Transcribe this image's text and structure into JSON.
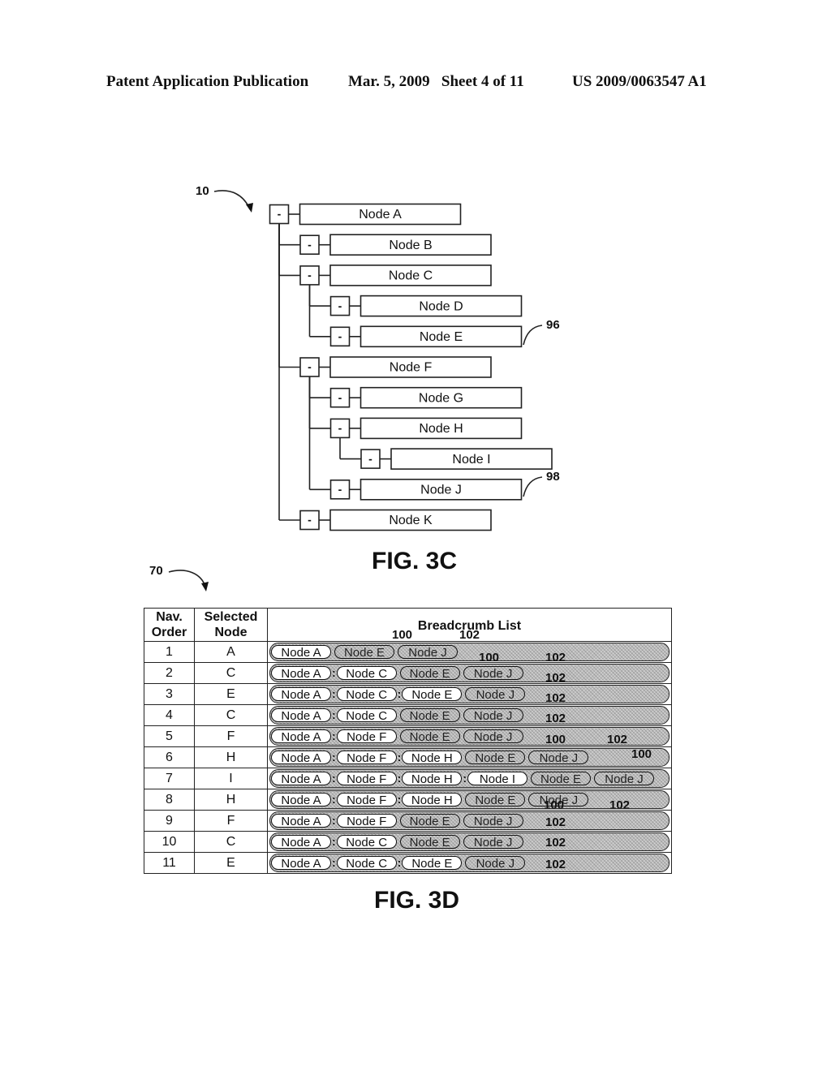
{
  "header": {
    "publication": "Patent Application Publication",
    "date_sheet": "Mar. 5, 2009   Sheet 4 of 11",
    "patent_number": "US 2009/0063547 A1"
  },
  "fig3c": {
    "label": "FIG. 3C",
    "ref_tree": "10",
    "ref_node_e": "96",
    "ref_node_j": "98",
    "toggle_symbol": "-",
    "nodes": [
      {
        "id": "A",
        "label": "Node A",
        "depth": 0,
        "highlighted": false
      },
      {
        "id": "B",
        "label": "Node B",
        "depth": 1,
        "highlighted": false
      },
      {
        "id": "C",
        "label": "Node C",
        "depth": 1,
        "highlighted": false
      },
      {
        "id": "D",
        "label": "Node D",
        "depth": 2,
        "highlighted": false
      },
      {
        "id": "E",
        "label": "Node E",
        "depth": 2,
        "highlighted": true
      },
      {
        "id": "F",
        "label": "Node F",
        "depth": 1,
        "highlighted": false
      },
      {
        "id": "G",
        "label": "Node G",
        "depth": 2,
        "highlighted": false
      },
      {
        "id": "H",
        "label": "Node H",
        "depth": 2,
        "highlighted": false
      },
      {
        "id": "I",
        "label": "Node I",
        "depth": 3,
        "highlighted": false
      },
      {
        "id": "J",
        "label": "Node J",
        "depth": 2,
        "highlighted": true
      },
      {
        "id": "K",
        "label": "Node K",
        "depth": 1,
        "highlighted": false
      }
    ]
  },
  "fig3d": {
    "label": "FIG. 3D",
    "ref_table": "70",
    "columns": {
      "nav_order": "Nav. Order",
      "selected_node": "Selected Node",
      "breadcrumb_list": "Breadcrumb List"
    },
    "rows": [
      {
        "order": "1",
        "selected": "A",
        "active": [
          "Node A"
        ],
        "ghost": [
          "Node E",
          "Node J"
        ]
      },
      {
        "order": "2",
        "selected": "C",
        "active": [
          "Node A",
          "Node C"
        ],
        "ghost": [
          "Node E",
          "Node J"
        ]
      },
      {
        "order": "3",
        "selected": "E",
        "active": [
          "Node A",
          "Node C",
          "Node E"
        ],
        "ghost": [
          "Node J"
        ]
      },
      {
        "order": "4",
        "selected": "C",
        "active": [
          "Node A",
          "Node C"
        ],
        "ghost": [
          "Node E",
          "Node J"
        ]
      },
      {
        "order": "5",
        "selected": "F",
        "active": [
          "Node A",
          "Node F"
        ],
        "ghost": [
          "Node E",
          "Node J"
        ]
      },
      {
        "order": "6",
        "selected": "H",
        "active": [
          "Node A",
          "Node F",
          "Node H"
        ],
        "ghost": [
          "Node E",
          "Node J"
        ]
      },
      {
        "order": "7",
        "selected": "I",
        "active": [
          "Node A",
          "Node F",
          "Node H",
          "Node I"
        ],
        "ghost": [
          "Node E",
          "Node J"
        ]
      },
      {
        "order": "8",
        "selected": "H",
        "active": [
          "Node A",
          "Node F",
          "Node H"
        ],
        "ghost": [
          "Node E",
          "Node J"
        ]
      },
      {
        "order": "9",
        "selected": "F",
        "active": [
          "Node A",
          "Node F"
        ],
        "ghost": [
          "Node E",
          "Node J"
        ]
      },
      {
        "order": "10",
        "selected": "C",
        "active": [
          "Node A",
          "Node C"
        ],
        "ghost": [
          "Node E",
          "Node J"
        ]
      },
      {
        "order": "11",
        "selected": "E",
        "active": [
          "Node A",
          "Node C",
          "Node E"
        ],
        "ghost": [
          "Node J"
        ]
      }
    ],
    "annotations": [
      "100",
      "102",
      "100",
      "102",
      "102",
      "102",
      "102",
      "100",
      "102",
      "100",
      "100",
      "102",
      "102",
      "102",
      "102"
    ]
  }
}
